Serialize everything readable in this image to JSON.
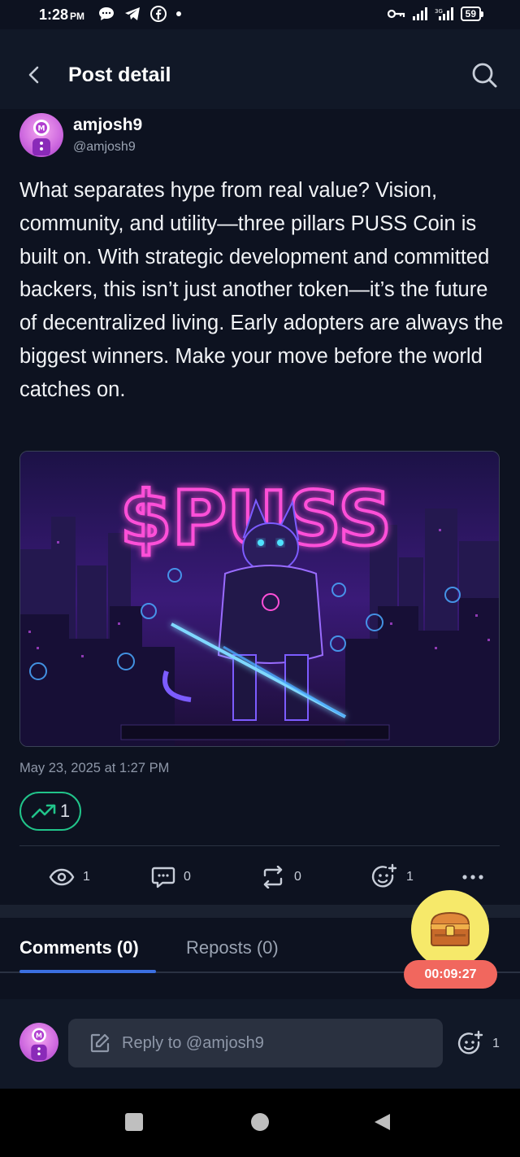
{
  "status_bar": {
    "time": "1:28",
    "ampm": "PM",
    "battery": "59"
  },
  "header": {
    "title": "Post detail"
  },
  "post": {
    "author_name": "amjosh9",
    "author_handle": "@amjosh9",
    "body": "What separates hype from real value? Vision, community, and utility—three pillars PUSS Coin is built on. With strategic development and committed backers, this isn’t just another token—it’s the future of decentralized living. Early adopters are always the biggest winners. Make your move before the world catches on.",
    "image_text": "$PUSS",
    "date": "May 23, 2025 at 1:27 PM",
    "trend_count": "1",
    "stats": {
      "views": "1",
      "comments": "0",
      "reposts": "0",
      "reactions": "1"
    }
  },
  "tabs": [
    {
      "label": "Comments (0)",
      "active": true
    },
    {
      "label": "Reposts (0)",
      "active": false
    }
  ],
  "reward": {
    "timer": "00:09:27"
  },
  "reply": {
    "placeholder": "Reply to @amjosh9",
    "reaction_count": "1"
  },
  "colors": {
    "background": "#0d1220",
    "accent": "#3b6fe0",
    "trend_green": "#21c48a",
    "timer_red": "#f1675e",
    "chest_yellow": "#f6e96a",
    "neon_pink": "#ff4fd8"
  }
}
